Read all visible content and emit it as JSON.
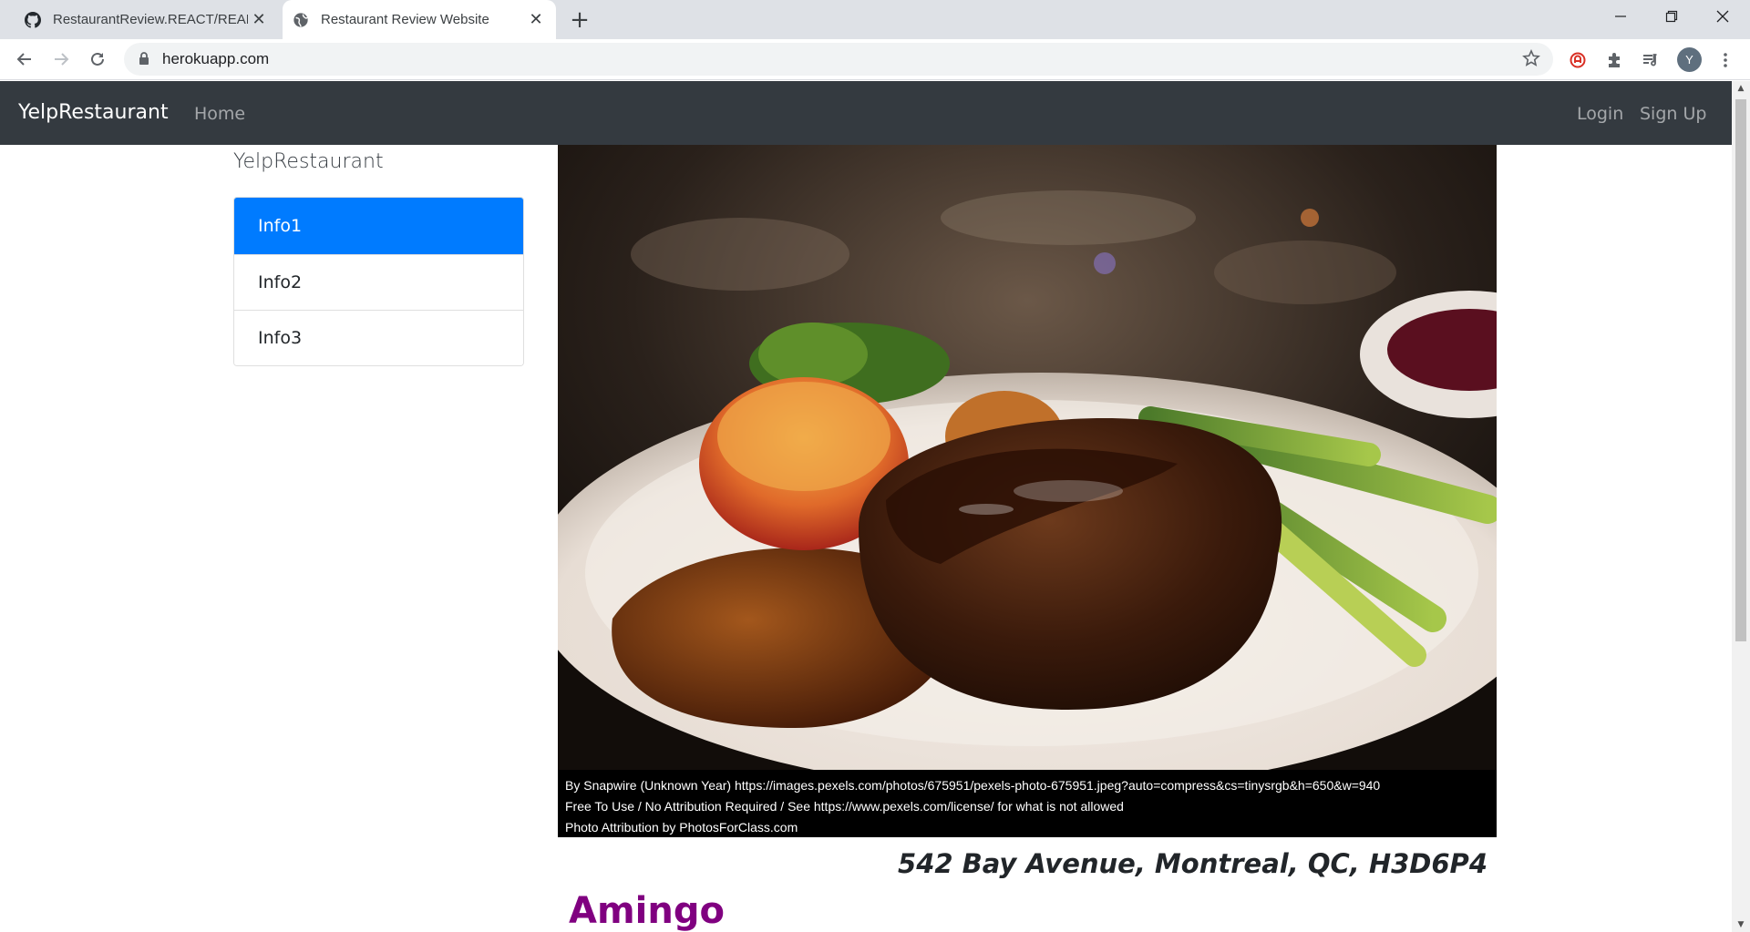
{
  "browser": {
    "tabs": [
      {
        "title": "RestaurantReview.REACT/READM",
        "active": false
      },
      {
        "title": "Restaurant Review Website",
        "active": true
      }
    ],
    "url": "herokuapp.com",
    "profile_initial": "Y"
  },
  "navbar": {
    "brand": "YelpRestaurant",
    "home": "Home",
    "login": "Login",
    "signup": "Sign Up"
  },
  "sidebar": {
    "title": "YelpRestaurant",
    "items": [
      {
        "label": "Info1",
        "active": true
      },
      {
        "label": "Info2",
        "active": false
      },
      {
        "label": "Info3",
        "active": false
      }
    ]
  },
  "hero": {
    "caption_line1": "By  Snapwire  (Unknown  Year)  https://images.pexels.com/photos/675951/pexels-photo-675951.jpeg?auto=compress&cs=tinysrgb&h=650&w=940",
    "caption_line2": "Free To Use / No Attribution Required / See https://www.pexels.com/license/ for what is not allowed",
    "caption_line3": "Photo Attribution by PhotosForClass.com"
  },
  "restaurant": {
    "address": "542 Bay Avenue, Montreal, QC, H3D6P4",
    "name": "Amingo"
  },
  "colors": {
    "navbar_bg": "#343a40",
    "active_item": "#007bff",
    "restaurant_name": "#800080"
  }
}
